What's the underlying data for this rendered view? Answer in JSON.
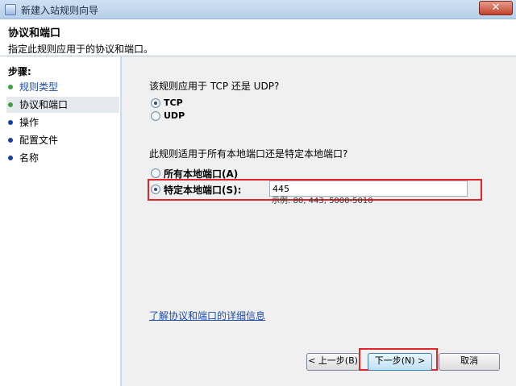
{
  "window": {
    "title": "新建入站规则向导",
    "close": "✕"
  },
  "header": {
    "title": "协议和端口",
    "subtitle": "指定此规则应用于的协议和端口。"
  },
  "steps": {
    "title": "步骤:",
    "items": [
      {
        "label": "规则类型"
      },
      {
        "label": "协议和端口"
      },
      {
        "label": "操作"
      },
      {
        "label": "配置文件"
      },
      {
        "label": "名称"
      }
    ]
  },
  "main": {
    "protocol_question": "该规则应用于 TCP 还是 UDP?",
    "tcp_label": "TCP",
    "udp_label": "UDP",
    "port_question": "此规则适用于所有本地端口还是特定本地端口?",
    "all_ports_label": "所有本地端口(A)",
    "specific_ports_label": "特定本地端口(S):",
    "port_value": "445",
    "example_text": "示例: 80, 443, 5000-5010",
    "link_text": "了解协议和端口的详细信息"
  },
  "buttons": {
    "prev": "< 上一步(B)",
    "next": "下一步(N) >",
    "cancel": "取消"
  },
  "colors": {
    "highlight": "#e0262a",
    "link": "#1f4da8",
    "step_done": "#3ea243",
    "step_pending": "#1c3f9c"
  }
}
